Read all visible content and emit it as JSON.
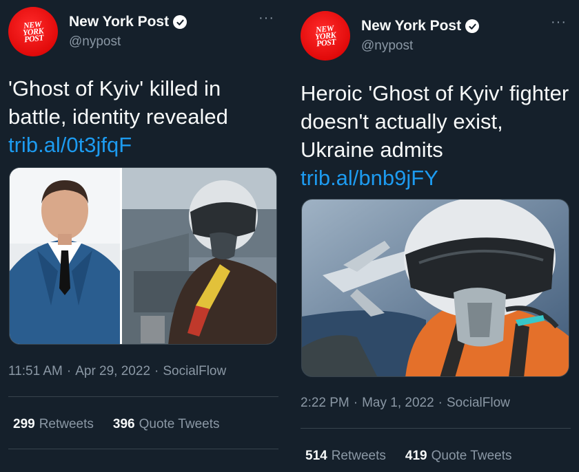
{
  "tweets": [
    {
      "account": {
        "logo_text": "NEW\nYORK\nPOST",
        "display_name": "New York Post",
        "handle": "@nypost",
        "more_glyph": "···"
      },
      "text": "'Ghost of Kyiv' killed in battle, identity revealed",
      "link": "trib.al/0t3jfqF",
      "timestamp": {
        "time": "11:51 AM",
        "sep1": "·",
        "date": "Apr 29, 2022",
        "sep2": "·",
        "source": "SocialFlow"
      },
      "stats": {
        "retweets_count": "299",
        "retweets_label": "Retweets",
        "quotes_count": "396",
        "quotes_label": "Quote Tweets"
      }
    },
    {
      "account": {
        "logo_text": "NEW\nYORK\nPOST",
        "display_name": "New York Post",
        "handle": "@nypost",
        "more_glyph": "···"
      },
      "text": "Heroic 'Ghost of Kyiv' fighter doesn't actually exist, Ukraine admits",
      "link": "trib.al/bnb9jFY",
      "timestamp": {
        "time": "2:22 PM",
        "sep1": "·",
        "date": "May 1, 2022",
        "sep2": "·",
        "source": "SocialFlow"
      },
      "stats": {
        "retweets_count": "514",
        "retweets_label": "Retweets",
        "quotes_count": "419",
        "quotes_label": "Quote Tweets"
      }
    }
  ],
  "colors": {
    "background": "#15202b",
    "link": "#1d9bf0",
    "secondary_text": "#8b98a5",
    "divider": "#38444d",
    "brand_red": "#e10a0a"
  },
  "icons": {
    "verified": "verified-badge-icon",
    "more": "more-options-icon"
  }
}
